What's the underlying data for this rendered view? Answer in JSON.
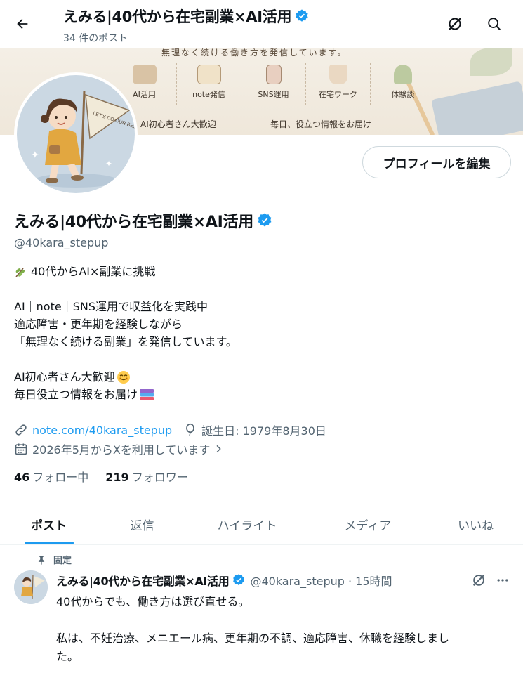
{
  "header": {
    "title": "えみる|40代から在宅副業×AI活用",
    "post_count": "34 件のポスト"
  },
  "banner": {
    "top_text": "無理なく続ける働き方を発信しています。",
    "items": [
      "AI活用",
      "note発信",
      "SNS運用",
      "在宅ワーク",
      "体験談"
    ],
    "bottom_left": "AI初心者さん大歓迎",
    "bottom_right": "毎日、役立つ情報をお届け",
    "flag_text": "LET'S DO OUR BEST!"
  },
  "profile": {
    "edit_button": "プロフィールを編集",
    "name": "えみる|40代から在宅副業×AI活用",
    "handle": "@40kara_stepup",
    "bio": {
      "line1": "40代からAI×副業に挑戦",
      "line2": "AI｜note｜SNS運用で収益化を実践中",
      "line3": "適応障害・更年期を経験しながら",
      "line4": "「無理なく続ける副業」を発信しています。",
      "line5": "AI初心者さん大歓迎",
      "line6": "毎日役立つ情報をお届け"
    },
    "website": "note.com/40kara_stepup",
    "birthday": "誕生日: 1979年8月30日",
    "joined": "2026年5月からXを利用しています",
    "following_count": "46",
    "following_label": "フォロー中",
    "followers_count": "219",
    "followers_label": "フォロワー"
  },
  "tabs": [
    {
      "label": "ポスト",
      "active": true
    },
    {
      "label": "返信",
      "active": false
    },
    {
      "label": "ハイライト",
      "active": false
    },
    {
      "label": "メディア",
      "active": false
    },
    {
      "label": "いいね",
      "active": false
    }
  ],
  "pinned_tweet": {
    "pinned_label": "固定",
    "author_name": "えみる|40代から在宅副業×AI活用",
    "author_meta": "@40kara_stepup · 15時間",
    "text_line1": "40代からでも、働き方は選び直せる。",
    "text_line2": "私は、不妊治療、メニエール病、更年期の不調、適応障害、休職を経験しまし",
    "text_line3": "た。"
  },
  "colors": {
    "accent": "#1d9bf0",
    "verified": "#1d9bf0",
    "secondary_text": "#536471",
    "primary_text": "#0f1419"
  },
  "icons": [
    "back-arrow-icon",
    "grok-icon",
    "search-icon",
    "verified-badge-icon",
    "link-icon",
    "balloon-icon",
    "calendar-icon",
    "chevron-right-icon",
    "pin-icon",
    "more-icon",
    "sprout-emoji",
    "smile-emoji",
    "books-emoji"
  ]
}
